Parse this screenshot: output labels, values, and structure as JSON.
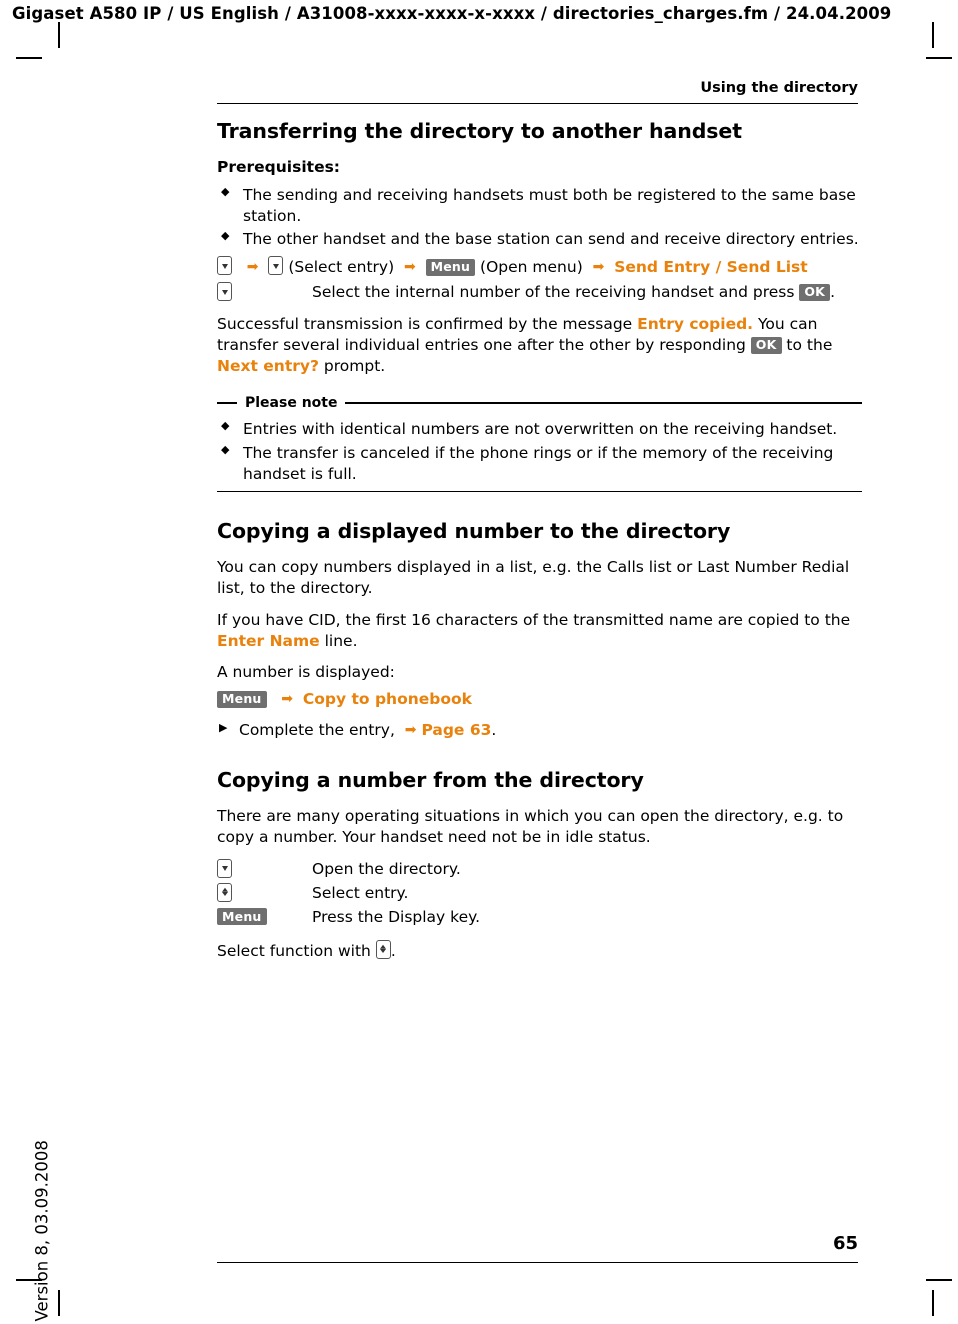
{
  "header": {
    "file_line": "Gigaset A580 IP / US English / A31008-xxxx-xxxx-x-xxxx / directories_charges.fm / 24.04.2009",
    "running_head": "Using the directory"
  },
  "side": {
    "version_text": "Version 8, 03.09.2008"
  },
  "footer": {
    "page_number": "65"
  },
  "sections": {
    "transfer": {
      "title": "Transferring the directory to another handset",
      "prereq_label": "Prerequisites:",
      "bullets": [
        "The sending and receiving handsets must both be registered to the same base station.",
        "The other handset and the base station can send and receive directory entries."
      ],
      "step1": {
        "select_entry": "(Select entry)",
        "menu_key": "Menu",
        "open_menu": "(Open menu)",
        "send_entry": "Send Entry / Send List"
      },
      "step2": {
        "text_before": "Select the internal number of the receiving handset and press",
        "ok_key": "OK",
        "text_after": "."
      },
      "para1_a": "Successful transmission is confirmed by the message ",
      "para1_msg": "Entry copied.",
      "para1_b": " You can transfer several individual entries one after the other by responding ",
      "para1_ok": "OK",
      "para1_c": " to the ",
      "para1_prompt": "Next entry?",
      "para1_d": " prompt.",
      "note": {
        "title": "Please note",
        "bullets": [
          "Entries with identical numbers are not overwritten on the receiving handset.",
          "The transfer is canceled if the phone rings or if the memory of the receiving handset is full."
        ]
      }
    },
    "copy_to": {
      "title": "Copying a displayed number to the directory",
      "para1": "You can copy numbers displayed in a list, e.g. the Calls list or Last Number Redial list, to the directory.",
      "para2_a": "If you have CID, the first 16 characters of the transmitted name are copied to the ",
      "para2_key": "Enter Name",
      "para2_b": " line.",
      "para3": "A number is displayed:",
      "menu_key": "Menu",
      "copy_to_phonebook": "Copy to phonebook",
      "complete_entry": "Complete the entry,",
      "page_ref": "Page 63",
      "period": "."
    },
    "copy_from": {
      "title": "Copying a number from the directory",
      "para1": "There are many operating situations in which you can open the directory, e.g. to copy a number. Your handset need not be in idle status.",
      "steps": [
        {
          "key": "down-arrow-key",
          "desc": "Open the directory."
        },
        {
          "key": "updown-arrow-key",
          "desc": "Select entry."
        },
        {
          "key": "Menu",
          "desc": "Press the Display key."
        }
      ],
      "closing_a": "Select function with ",
      "closing_b": "."
    }
  },
  "colors": {
    "accent_orange": "#E8820C",
    "key_gray": "#6F6F6F"
  }
}
